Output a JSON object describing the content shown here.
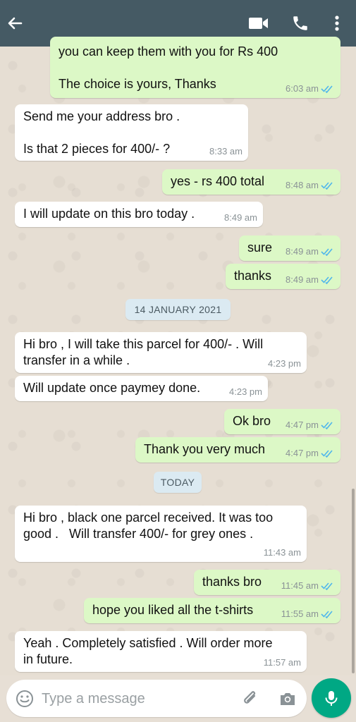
{
  "header": {
    "back_icon": "arrow-left-icon",
    "video_icon": "video-call-icon",
    "call_icon": "phone-icon",
    "menu_icon": "more-vertical-icon",
    "bg_color": "#455a64"
  },
  "messages": [
    {
      "dir": "out",
      "text": "you can keep them with you for Rs 400\n\nThe choice is yours, Thanks",
      "time": "6:03 am",
      "ticks": "read"
    },
    {
      "dir": "in",
      "text": "Send me your address bro .\n\nIs that 2 pieces for 400/- ?",
      "time": "8:33 am"
    },
    {
      "dir": "out",
      "text": "yes - rs 400 total",
      "time": "8:48 am",
      "ticks": "read"
    },
    {
      "dir": "in",
      "text": "I will update on this bro today .",
      "time": "8:49 am"
    },
    {
      "dir": "out",
      "text": "sure",
      "time": "8:49 am",
      "ticks": "read"
    },
    {
      "dir": "out",
      "text": "thanks",
      "time": "8:49 am",
      "ticks": "read"
    },
    {
      "dir": "date",
      "text": "14 JANUARY 2021"
    },
    {
      "dir": "in",
      "text": "Hi bro , I will take this parcel for 400/- . Will\ntransfer in a while .",
      "time": "4:23 pm"
    },
    {
      "dir": "in",
      "text": "Will update once paymey done.",
      "time": "4:23 pm"
    },
    {
      "dir": "out",
      "text": "Ok bro",
      "time": "4:47 pm",
      "ticks": "read"
    },
    {
      "dir": "out",
      "text": "Thank you very much",
      "time": "4:47 pm",
      "ticks": "read"
    },
    {
      "dir": "date",
      "text": "TODAY"
    },
    {
      "dir": "in",
      "text": "Hi bro , black one parcel received. It was too\ngood .   Will transfer 400/- for grey ones .",
      "time": "11:43 am"
    },
    {
      "dir": "out",
      "text": "thanks bro",
      "time": "11:45 am",
      "ticks": "read"
    },
    {
      "dir": "out",
      "text": "hope you liked all the t-shirts",
      "time": "11:55 am",
      "ticks": "read"
    },
    {
      "dir": "in",
      "text": "Yeah . Completely satisfied . Will order more\nin future.",
      "time": "11:57 am"
    }
  ],
  "composer": {
    "placeholder": "Type a message",
    "emoji_icon": "emoji-icon",
    "attach_icon": "paperclip-icon",
    "camera_icon": "camera-icon",
    "mic_icon": "microphone-icon",
    "accent": "#00a884"
  },
  "colors": {
    "outgoing_bubble": "#dcf8c6",
    "incoming_bubble": "#ffffff",
    "read_tick": "#4fb6ec",
    "chat_background": "#e6ded3"
  }
}
